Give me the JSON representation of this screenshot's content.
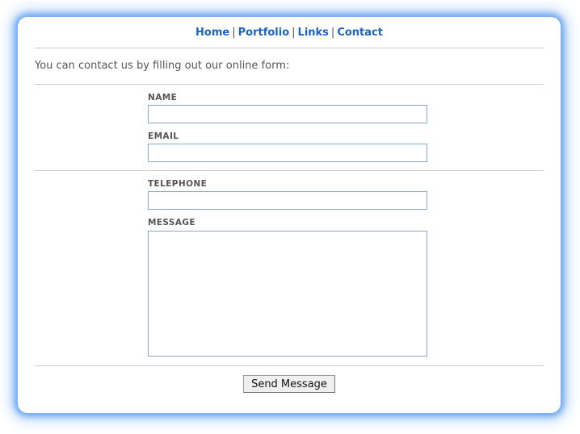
{
  "nav": {
    "home": "Home",
    "portfolio": "Portfolio",
    "links": "Links",
    "contact": "Contact",
    "separator": "|"
  },
  "intro": "You can contact us by filling out our online form:",
  "form": {
    "name_label": "NAME",
    "email_label": "EMAIL",
    "telephone_label": "TELEPHONE",
    "message_label": "MESSAGE",
    "name_value": "",
    "email_value": "",
    "telephone_value": "",
    "message_value": "",
    "submit_label": "Send Message"
  },
  "colors": {
    "link": "#1a63c7",
    "glow": "#6aa6f0",
    "text": "#555555",
    "field_border": "#8aa6c8"
  }
}
